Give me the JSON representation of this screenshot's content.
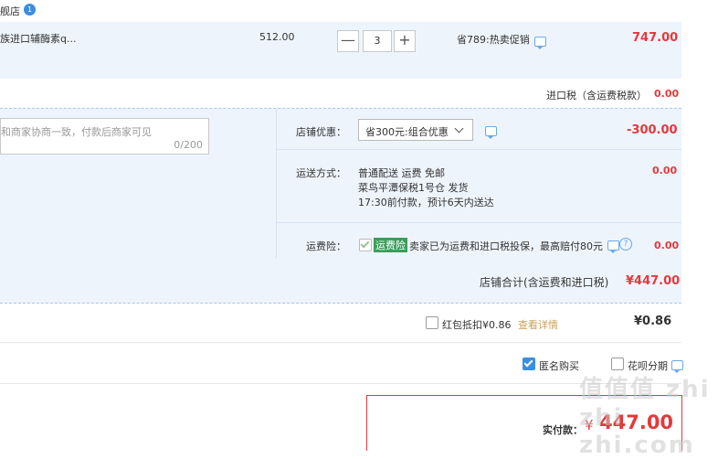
{
  "shop": {
    "name_fragment": "舰店",
    "badge": "1"
  },
  "item": {
    "name": "族进口辅酶素q...",
    "unit_price": "512.00",
    "quantity": "3",
    "minus": "—",
    "plus": "+",
    "promo": "省789:热卖促销",
    "total": "747.00"
  },
  "import_tax": {
    "label": "进口税（含运费税款）",
    "value": "0.00"
  },
  "message": {
    "placeholder": "和商家协商一致，付款后商家可见",
    "counter": "0/200"
  },
  "shop_discount": {
    "label": "店铺优惠：",
    "selected": "省300元:组合优惠",
    "value": "-300.00"
  },
  "shipping": {
    "label": "运送方式：",
    "line1": "普通配送 运费 免邮",
    "line2": "菜鸟平潭保税1号仓   发货",
    "line3": "17:30前付款，预计6天内送达",
    "value": "0.00"
  },
  "freight_insurance": {
    "label": "运费险：",
    "tag": "运费险",
    "text": "卖家已为运费和进口税投保，最高赔付80元",
    "value": "0.00"
  },
  "shop_total": {
    "label": "店铺合计(含运费和进口税)",
    "value": "¥447.00"
  },
  "red_packet": {
    "label": "红包抵扣¥0.86",
    "link": "查看详情",
    "value": "¥0.86"
  },
  "options": {
    "anonymous": "匿名购买",
    "huabei": "花呗分期"
  },
  "payment": {
    "label": "实付款：",
    "value": "447.00",
    "currency": "¥"
  },
  "watermark": "值​值​值 zhi zhi zhi.com",
  "colors": {
    "accent": "#e4393c",
    "blue": "#3b8de0",
    "panel": "#eef4fc",
    "green_tag": "#3a9e5a"
  }
}
